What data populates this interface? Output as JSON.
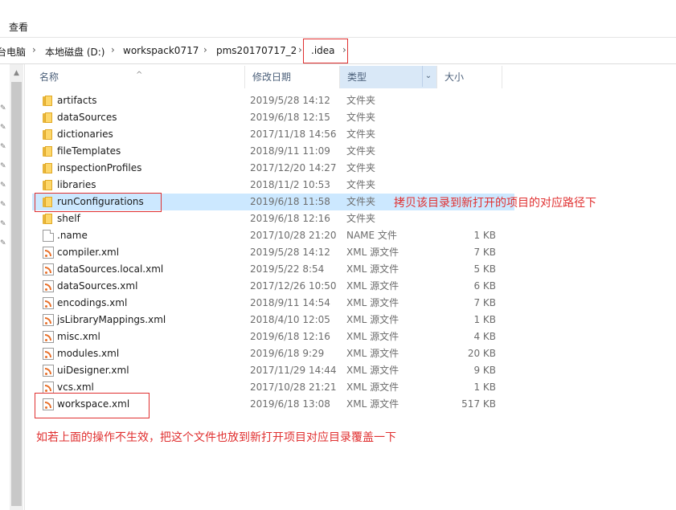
{
  "ribbon": {
    "tab_view": "查看"
  },
  "breadcrumb": {
    "items": [
      "台电脑",
      "本地磁盘 (D:)",
      "workspack0717",
      "pms20170717_2",
      ".idea"
    ]
  },
  "columns": {
    "name": "名称",
    "date": "修改日期",
    "type": "类型",
    "size": "大小"
  },
  "files": [
    {
      "name": "artifacts",
      "date": "2019/5/28 14:12",
      "type": "文件夹",
      "size": "",
      "icon": "folder-icon"
    },
    {
      "name": "dataSources",
      "date": "2019/6/18 12:15",
      "type": "文件夹",
      "size": "",
      "icon": "folder-icon"
    },
    {
      "name": "dictionaries",
      "date": "2017/11/18 14:56",
      "type": "文件夹",
      "size": "",
      "icon": "folder-icon"
    },
    {
      "name": "fileTemplates",
      "date": "2018/9/11 11:09",
      "type": "文件夹",
      "size": "",
      "icon": "folder-icon"
    },
    {
      "name": "inspectionProfiles",
      "date": "2017/12/20 14:27",
      "type": "文件夹",
      "size": "",
      "icon": "folder-icon"
    },
    {
      "name": "libraries",
      "date": "2018/11/2 10:53",
      "type": "文件夹",
      "size": "",
      "icon": "folder-icon"
    },
    {
      "name": "runConfigurations",
      "date": "2019/6/18 11:58",
      "type": "文件夹",
      "size": "",
      "icon": "folder-icon",
      "selected": true
    },
    {
      "name": "shelf",
      "date": "2019/6/18 12:16",
      "type": "文件夹",
      "size": "",
      "icon": "folder-icon"
    },
    {
      "name": ".name",
      "date": "2017/10/28 21:20",
      "type": "NAME 文件",
      "size": "1 KB",
      "icon": "file-icon"
    },
    {
      "name": "compiler.xml",
      "date": "2019/5/28 14:12",
      "type": "XML 源文件",
      "size": "7 KB",
      "icon": "xml-icon"
    },
    {
      "name": "dataSources.local.xml",
      "date": "2019/5/22 8:54",
      "type": "XML 源文件",
      "size": "5 KB",
      "icon": "xml-icon"
    },
    {
      "name": "dataSources.xml",
      "date": "2017/12/26 10:50",
      "type": "XML 源文件",
      "size": "6 KB",
      "icon": "xml-icon"
    },
    {
      "name": "encodings.xml",
      "date": "2018/9/11 14:54",
      "type": "XML 源文件",
      "size": "7 KB",
      "icon": "xml-icon"
    },
    {
      "name": "jsLibraryMappings.xml",
      "date": "2018/4/10 12:05",
      "type": "XML 源文件",
      "size": "1 KB",
      "icon": "xml-icon"
    },
    {
      "name": "misc.xml",
      "date": "2019/6/18 12:16",
      "type": "XML 源文件",
      "size": "4 KB",
      "icon": "xml-icon"
    },
    {
      "name": "modules.xml",
      "date": "2019/6/18 9:29",
      "type": "XML 源文件",
      "size": "20 KB",
      "icon": "xml-icon"
    },
    {
      "name": "uiDesigner.xml",
      "date": "2017/11/29 14:44",
      "type": "XML 源文件",
      "size": "9 KB",
      "icon": "xml-icon"
    },
    {
      "name": "vcs.xml",
      "date": "2017/10/28 21:21",
      "type": "XML 源文件",
      "size": "1 KB",
      "icon": "xml-icon"
    },
    {
      "name": "workspace.xml",
      "date": "2019/6/18 13:08",
      "type": "XML 源文件",
      "size": "517 KB",
      "icon": "xml-icon"
    }
  ],
  "annotations": {
    "note_run_configurations": "拷贝该目录到新打开的项目的对应路径下",
    "note_workspace": "如若上面的操作不生效，把这个文件也放到新打开项目对应目录覆盖一下"
  },
  "colors": {
    "annotation": "#e03030",
    "selection": "#cce8ff",
    "header_active": "#d9e8f7"
  }
}
